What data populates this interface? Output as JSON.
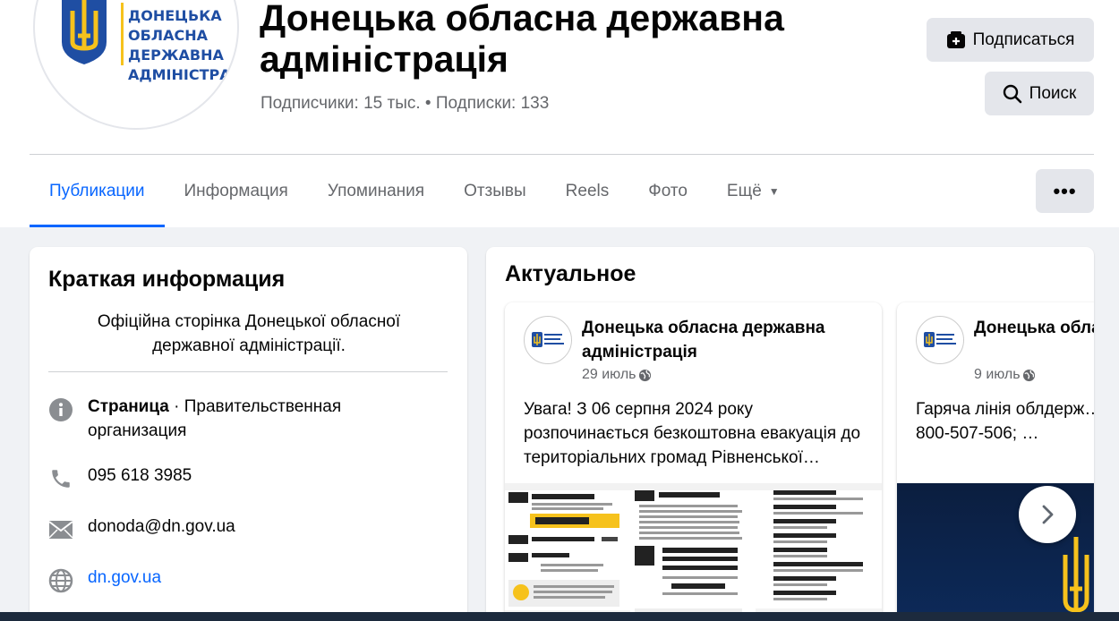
{
  "header": {
    "logo_lines": [
      "ДОНЕЦЬКА",
      "ОБЛАСНА",
      "ДЕРЖАВНА",
      "АДМІНІСТРАЦІЯ"
    ],
    "title_line1": "Донецька обласна державна",
    "title_line2": "адміністрація",
    "followers": "Подписчики: 15 тыс. • Подписки: 133",
    "subscribe_label": "Подписаться",
    "search_label": "Поиск"
  },
  "tabs": [
    {
      "label": "Публикации",
      "active": true
    },
    {
      "label": "Информация"
    },
    {
      "label": "Упоминания"
    },
    {
      "label": "Отзывы"
    },
    {
      "label": "Reels"
    },
    {
      "label": "Фото"
    },
    {
      "label": "Ещё"
    }
  ],
  "more_label": "•••",
  "intro": {
    "title": "Краткая информация",
    "bio": "Офіційна сторінка Донецької обласної державної адміністрації.",
    "category_label": "Страница",
    "category_value": " · Правительственная организация",
    "phone": "095 618 3985",
    "email": "donoda@dn.gov.ua",
    "website": "dn.gov.ua"
  },
  "featured": {
    "title": "Актуальное",
    "posts": [
      {
        "author": "Донецька обласна державна адміністрація",
        "date": "29 июль",
        "text": "Увага! З 06 серпня 2024 року розпочинається безкоштовна евакуація до територіальних громад Рівненської…"
      },
      {
        "author": "Донецька обласна державна адміністрація",
        "date": "9 июль",
        "text": "Гаряча лінія облдерж… 800-507-506; …"
      }
    ]
  },
  "colors": {
    "accent": "#0866ff",
    "secondary_text": "#65676b",
    "button_bg": "#e4e6eb",
    "page_bg": "#f0f2f5"
  }
}
